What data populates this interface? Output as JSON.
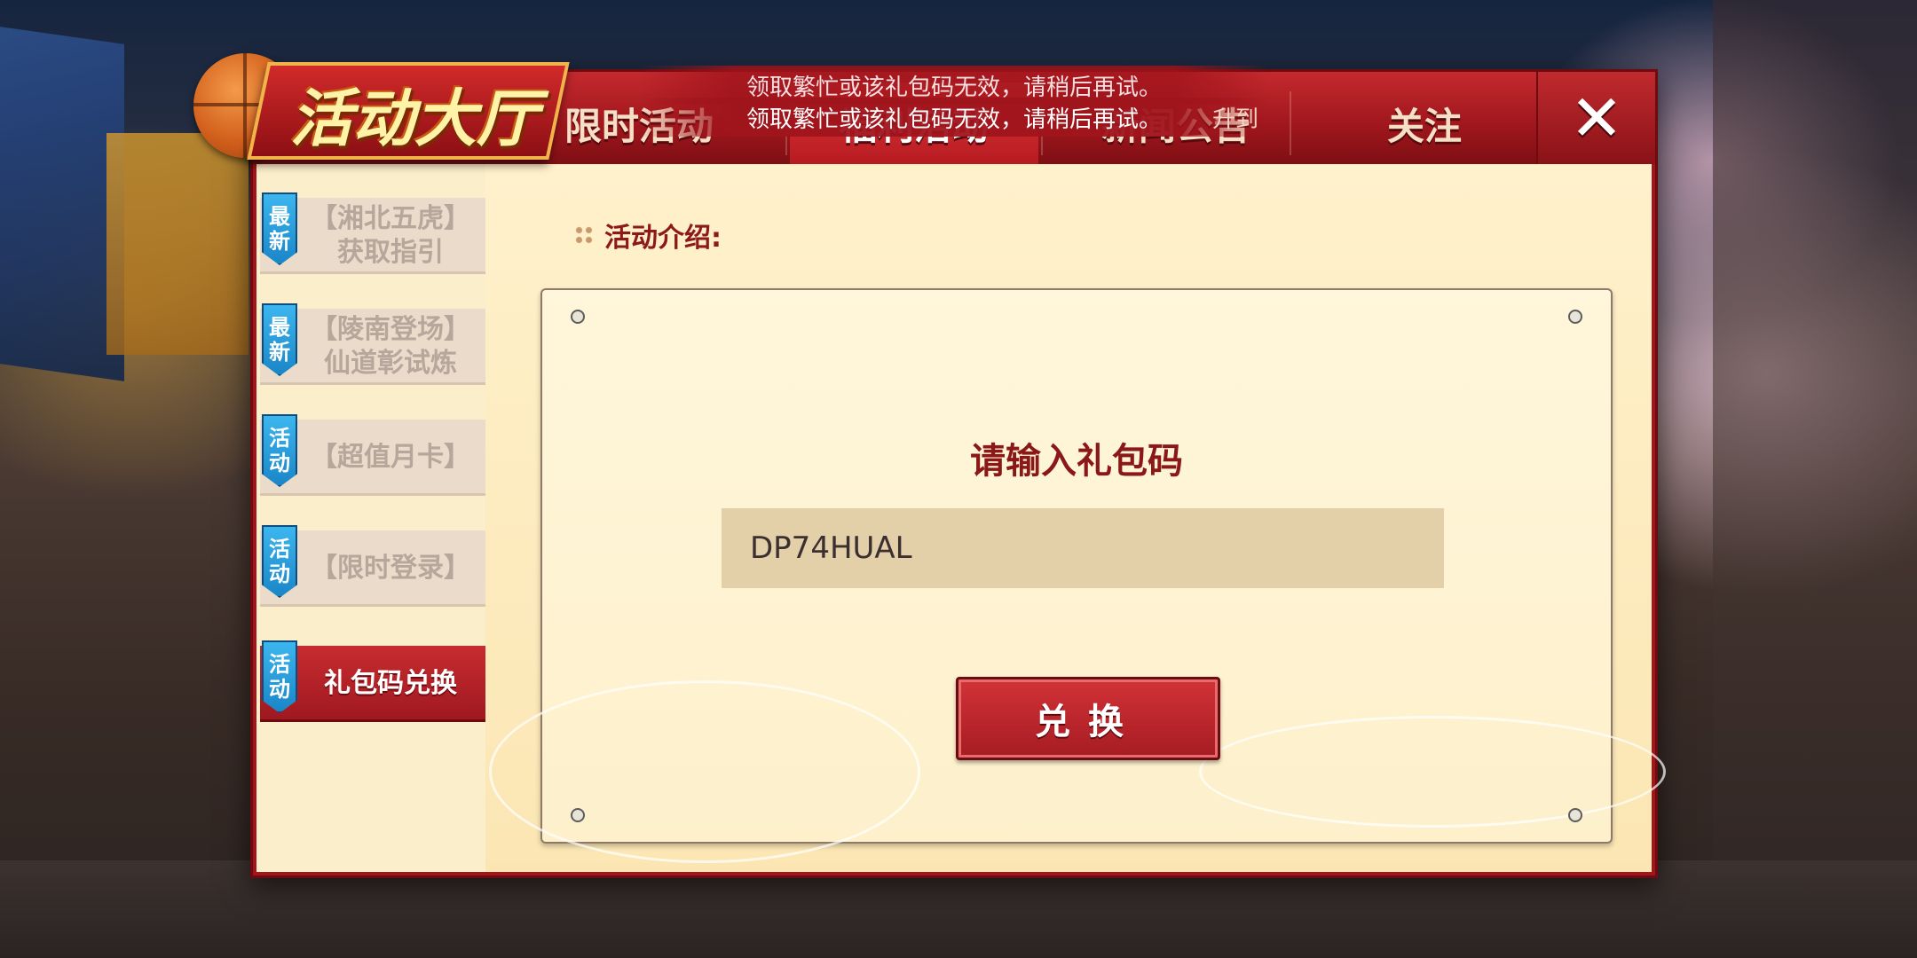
{
  "title": "活动大厅",
  "tabs": [
    {
      "label": "限时活动",
      "active": false
    },
    {
      "label": "福利活动",
      "active": true
    },
    {
      "label": "新闻公告",
      "active": false
    },
    {
      "label": "关注",
      "active": false
    }
  ],
  "close_label": "✕",
  "toasts": {
    "line1": "领取繁忙或该礼包码无效，请稍后再试。",
    "line2": "领取繁忙或该礼包码无效，请稍后再试。",
    "tail": "升到"
  },
  "sidebar": {
    "items": [
      {
        "tag": [
          "最",
          "新"
        ],
        "line1": "【湘北五虎】",
        "line2": "获取指引",
        "active": false
      },
      {
        "tag": [
          "最",
          "新"
        ],
        "line1": "【陵南登场】",
        "line2": "仙道彰试炼",
        "active": false
      },
      {
        "tag": [
          "活",
          "动"
        ],
        "line1": "【超值月卡】",
        "line2": "",
        "active": false
      },
      {
        "tag": [
          "活",
          "动"
        ],
        "line1": "【限时登录】",
        "line2": "",
        "active": false
      },
      {
        "tag": [
          "活",
          "动"
        ],
        "line1": "礼包码兑换",
        "line2": "",
        "active": true
      }
    ]
  },
  "content": {
    "intro_label": "活动介绍:",
    "panel_title": "请输入礼包码",
    "code_value": "DP74HUAL",
    "redeem_label": "兑换"
  },
  "colors": {
    "primary_red": "#a3151d",
    "accent_blue": "#1a86c8",
    "panel_bg": "#fdf0cb"
  }
}
